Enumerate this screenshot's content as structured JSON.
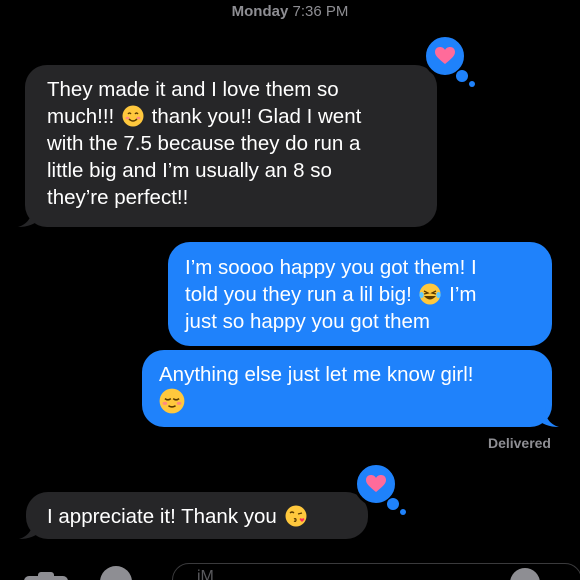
{
  "header": {
    "day": "Monday",
    "time": "7:36 PM"
  },
  "messages": [
    {
      "direction": "received",
      "lines": [
        "They made it and I love them so",
        "much!!! ",
        "with the 7.5 because they do run a",
        "little big and I’m usually an 8 so",
        "they’re perfect!!"
      ],
      "line2_after_emoji": " thank you!! Glad I went",
      "emoji": "smiling-face-icon",
      "reaction": "heart-icon"
    },
    {
      "direction": "sent",
      "lines": [
        "I’m soooo happy you got them! I",
        "told you they run a lil big! ",
        "just so happy you got them"
      ],
      "line2_after_emoji": " I’m",
      "emoji": "tears-of-joy-icon"
    },
    {
      "direction": "sent",
      "lines": [
        "Anything else just let me know girl!"
      ],
      "emoji": "relieved-face-icon"
    },
    {
      "direction": "received",
      "lines": [
        "I appreciate it! Thank you "
      ],
      "emoji": "kissing-face-icon",
      "reaction": "heart-icon"
    }
  ],
  "status": {
    "delivered_label": "Delivered"
  },
  "composer": {
    "placeholder": "iM"
  },
  "colors": {
    "sent_bubble": "#1f82fb",
    "received_bubble": "#262628",
    "heart": "#ff6b9a",
    "muted_text": "#8e8e93"
  }
}
